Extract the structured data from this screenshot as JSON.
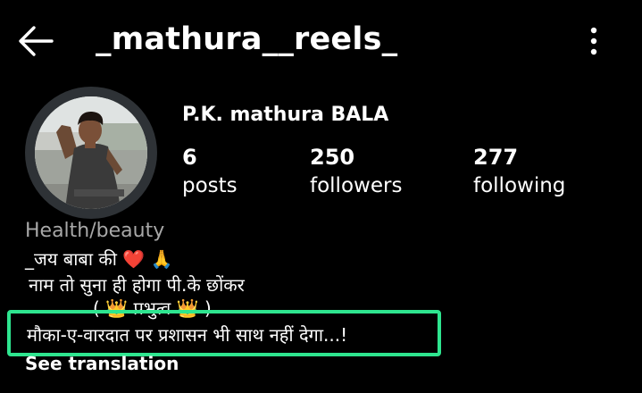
{
  "header": {
    "username": "_mathura__reels_",
    "back_icon": "arrow-left-icon",
    "more_icon": "more-vertical-icon"
  },
  "profile": {
    "display_name": "P.K. mathura BALA",
    "category": "Health/beauty",
    "stats": {
      "posts": {
        "count": "6",
        "label": "posts"
      },
      "followers": {
        "count": "250",
        "label": "followers"
      },
      "following": {
        "count": "277",
        "label": "following"
      }
    },
    "bio": {
      "line1_text": "_जय बाबा की",
      "line1_emoji1": "❤️",
      "line1_emoji2": "🙏",
      "line2": "नाम तो सुना ही होगा पी.के छोंकर",
      "line3_open": "(",
      "line3_crown1": "👑",
      "line3_text": "प्रभुत्व",
      "line3_crown2": "👑",
      "line3_close": ")",
      "line4": "मौका-ए-वारदात पर प्रशासन भी साथ नहीं देगा...!"
    },
    "see_translation": "See translation"
  },
  "colors": {
    "background": "#000000",
    "text": "#ffffff",
    "muted": "#a8a8a8",
    "highlight_border": "#2ee58f",
    "avatar_ring": "#2e3236"
  }
}
